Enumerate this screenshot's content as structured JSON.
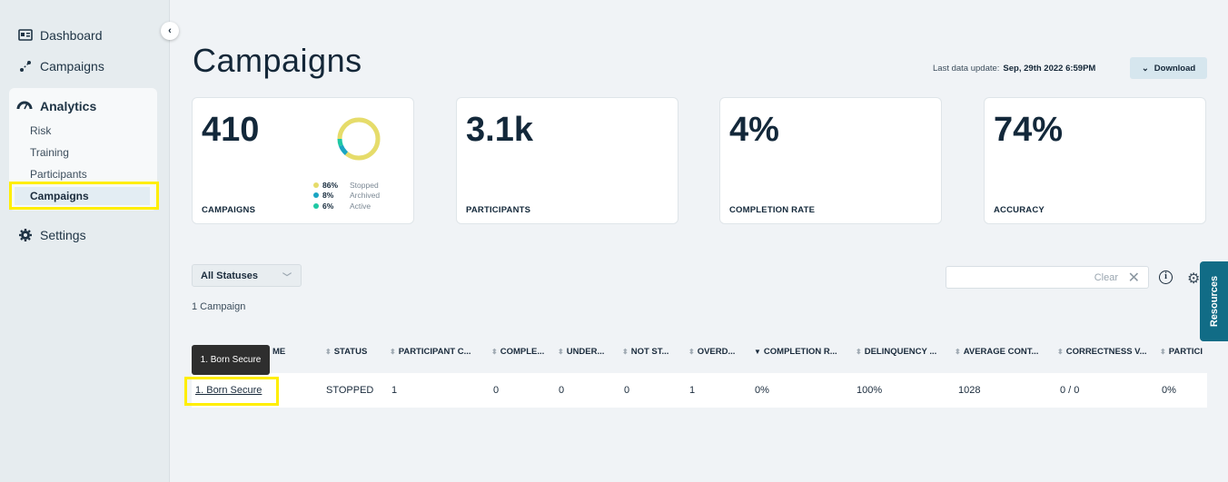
{
  "sidebar": {
    "items": [
      {
        "label": "Dashboard",
        "icon": "dashboard-icon"
      },
      {
        "label": "Campaigns",
        "icon": "campaigns-icon"
      }
    ],
    "analytics": {
      "label": "Analytics",
      "icon": "gauge-icon",
      "sub_items": [
        "Risk",
        "Training",
        "Participants",
        "Campaigns"
      ],
      "active": "Campaigns"
    },
    "settings": {
      "label": "Settings",
      "icon": "gear-icon"
    }
  },
  "header": {
    "title": "Campaigns",
    "last_update_label": "Last data update:",
    "last_update_value": "Sep, 29th 2022 6:59PM",
    "download_label": "Download"
  },
  "stats": [
    {
      "value": "410",
      "label": "CAMPAIGNS"
    },
    {
      "value": "3.1k",
      "label": "PARTICIPANTS"
    },
    {
      "value": "4%",
      "label": "COMPLETION RATE"
    },
    {
      "value": "74%",
      "label": "ACCURACY"
    }
  ],
  "donut": {
    "legend": [
      {
        "pct": "86%",
        "name": "Stopped",
        "color": "#e6dc6a",
        "fraction": 0.86
      },
      {
        "pct": "8%",
        "name": "Archived",
        "color": "#1aa5c2",
        "fraction": 0.08
      },
      {
        "pct": "6%",
        "name": "Active",
        "color": "#1fc8a4",
        "fraction": 0.06
      }
    ]
  },
  "filters": {
    "status_select": "All Statuses",
    "count_text": "1 Campaign",
    "search_clear": "Clear",
    "resources_label": "Resources"
  },
  "table": {
    "columns": [
      "ME",
      "STATUS",
      "PARTICIPANT C...",
      "COMPLE...",
      "UNDER...",
      "NOT ST...",
      "OVERD...",
      "COMPLETION R...",
      "DELINQUENCY ...",
      "AVERAGE CONT...",
      "CORRECTNESS V...",
      "PARTICI"
    ],
    "rows": [
      [
        "1. Born Secure",
        "STOPPED",
        "1",
        "0",
        "0",
        "0",
        "1",
        "0%",
        "100%",
        "1028",
        "0 / 0",
        "0%"
      ]
    ],
    "tooltip": "1. Born Secure"
  }
}
